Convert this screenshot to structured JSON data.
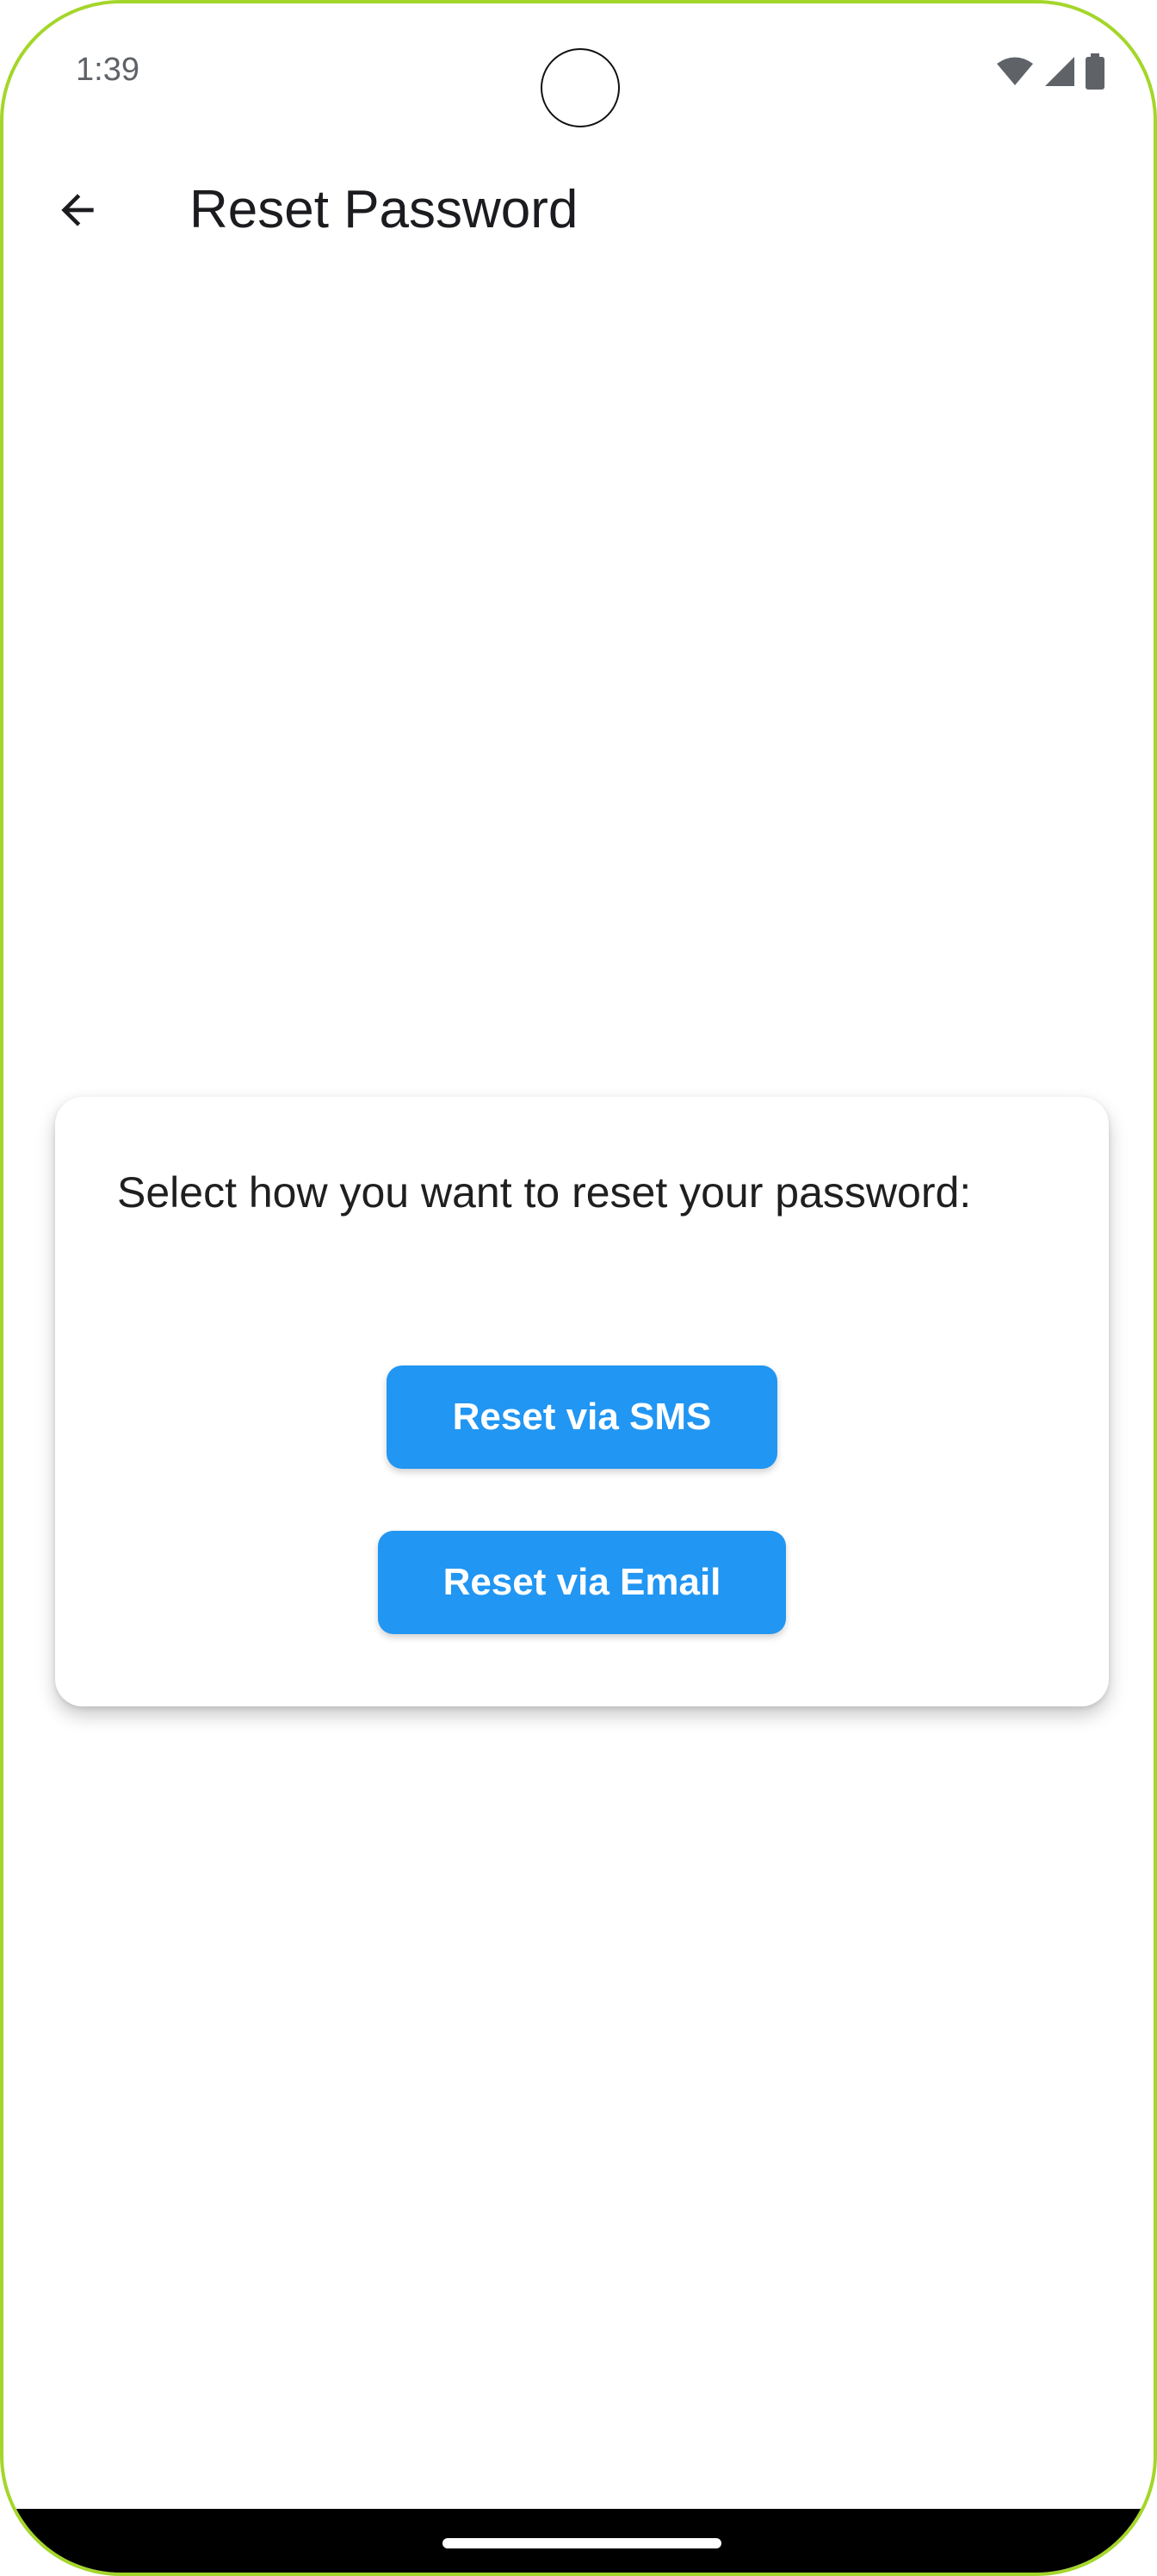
{
  "status_bar": {
    "time": "1:39",
    "icons": [
      "wifi-icon",
      "cellular-signal-icon",
      "battery-icon"
    ]
  },
  "app_bar": {
    "back_icon": "arrow-left-icon",
    "title": "Reset Password"
  },
  "card": {
    "prompt": "Select how you want to reset your password:",
    "sms_button_label": "Reset via SMS",
    "email_button_label": "Reset via Email"
  },
  "colors": {
    "button_bg": "#2196f3",
    "button_text": "#ffffff",
    "device_frame": "#a4d62a"
  }
}
